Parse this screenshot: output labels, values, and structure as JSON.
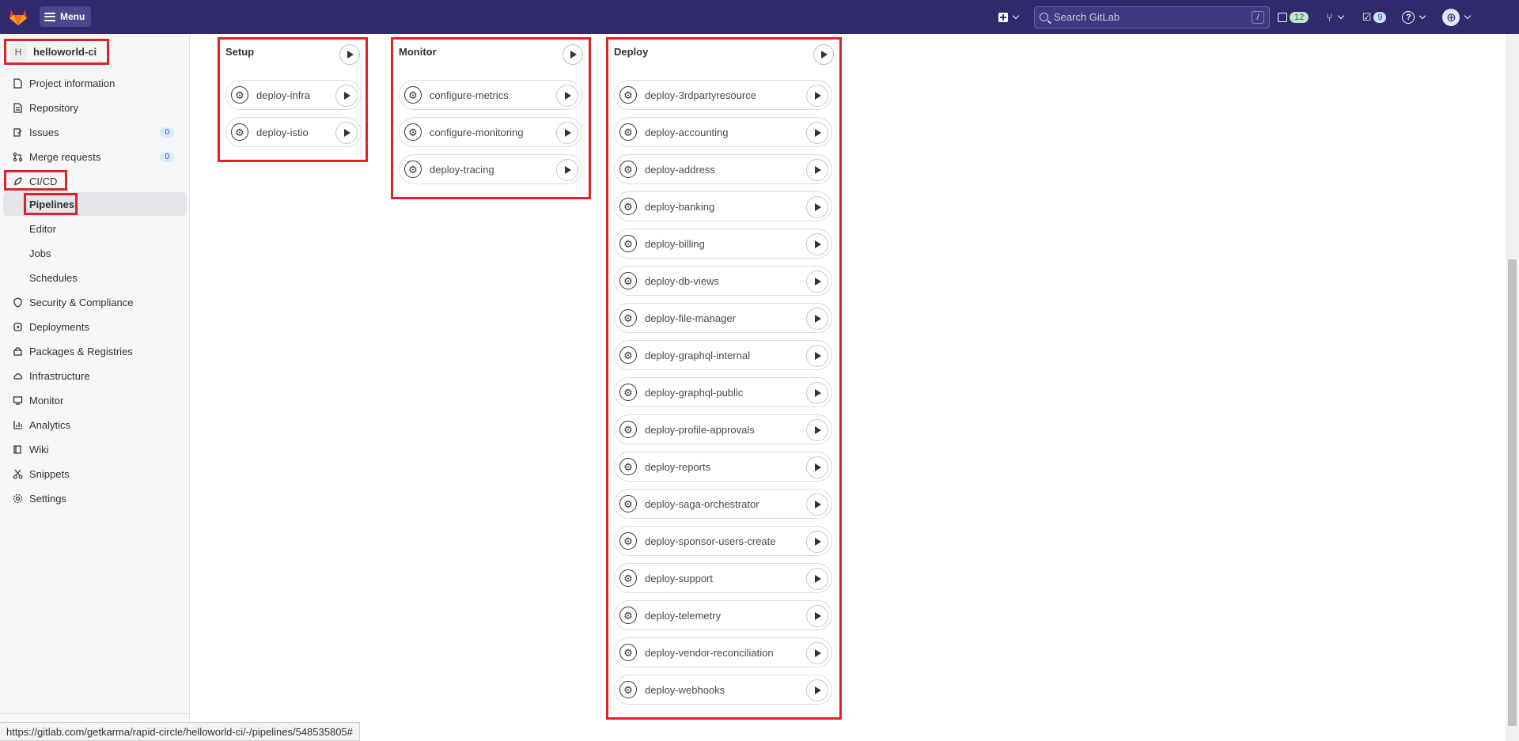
{
  "topbar": {
    "menu_label": "Menu",
    "search_placeholder": "Search GitLab",
    "search_shortcut": "/",
    "issues_count": "12",
    "todos_count": "9"
  },
  "sidebar": {
    "project_avatar": "H",
    "project_name": "helloworld-ci",
    "items": [
      {
        "label": "Project information",
        "icon": "info-icon"
      },
      {
        "label": "Repository",
        "icon": "doc-icon"
      },
      {
        "label": "Issues",
        "icon": "issues-icon",
        "count": "0"
      },
      {
        "label": "Merge requests",
        "icon": "merge-icon",
        "count": "0"
      },
      {
        "label": "CI/CD",
        "icon": "rocket-icon"
      },
      {
        "label": "Security & Compliance",
        "icon": "shield-icon"
      },
      {
        "label": "Deployments",
        "icon": "deploy-icon"
      },
      {
        "label": "Packages & Registries",
        "icon": "package-icon"
      },
      {
        "label": "Infrastructure",
        "icon": "cloud-icon"
      },
      {
        "label": "Monitor",
        "icon": "monitor-icon"
      },
      {
        "label": "Analytics",
        "icon": "chart-icon"
      },
      {
        "label": "Wiki",
        "icon": "book-icon"
      },
      {
        "label": "Snippets",
        "icon": "scissors-icon"
      },
      {
        "label": "Settings",
        "icon": "gear-icon"
      }
    ],
    "cicd_sub": [
      "Pipelines",
      "Editor",
      "Jobs",
      "Schedules"
    ]
  },
  "stages": [
    {
      "name": "Setup",
      "jobs": [
        "deploy-infra",
        "deploy-istio"
      ]
    },
    {
      "name": "Monitor",
      "jobs": [
        "configure-metrics",
        "configure-monitoring",
        "deploy-tracing"
      ]
    },
    {
      "name": "Deploy",
      "jobs": [
        "deploy-3rdpartyresource",
        "deploy-accounting",
        "deploy-address",
        "deploy-banking",
        "deploy-billing",
        "deploy-db-views",
        "deploy-file-manager",
        "deploy-graphql-internal",
        "deploy-graphql-public",
        "deploy-profile-approvals",
        "deploy-reports",
        "deploy-saga-orchestrator",
        "deploy-sponsor-users-create",
        "deploy-support",
        "deploy-telemetry",
        "deploy-vendor-reconciliation",
        "deploy-webhooks"
      ]
    }
  ],
  "status_url": "https://gitlab.com/getkarma/rapid-circle/helloworld-ci/-/pipelines/548535805#",
  "colors": {
    "topbar": "#2f2a6b",
    "highlight": "#e0212a"
  }
}
